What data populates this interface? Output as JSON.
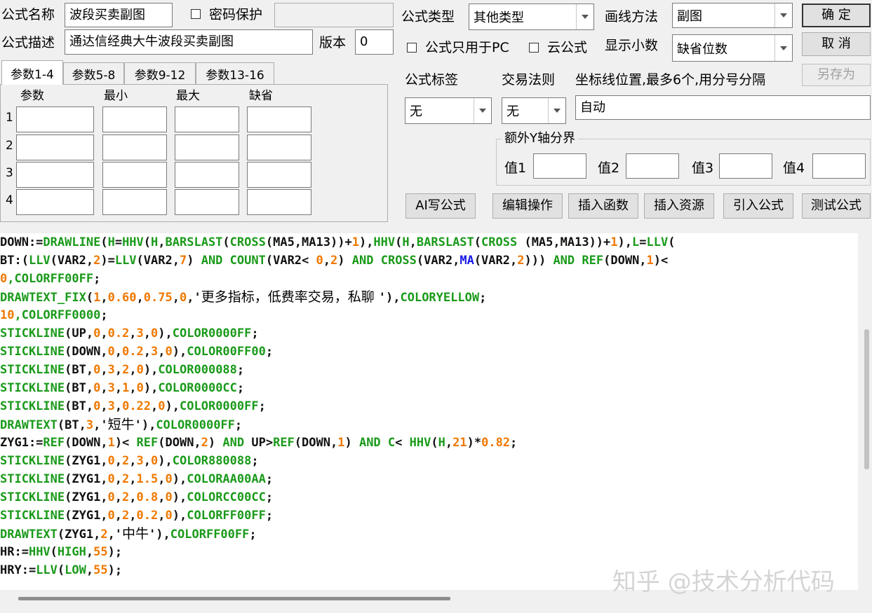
{
  "header": {
    "formula_name_label": "公式名称",
    "formula_name_value": "波段买卖副图",
    "password_label": "密码保护",
    "formula_desc_label": "公式描述",
    "formula_desc_value": "通达信经典大牛波段买卖副图",
    "version_label": "版本",
    "version_value": "0",
    "formula_type_label": "公式类型",
    "formula_type_value": "其他类型",
    "draw_method_label": "画线方法",
    "draw_method_value": "副图",
    "pc_only_label": "公式只用于PC",
    "cloud_label": "云公式",
    "decimals_label": "显示小数",
    "decimals_value": "缺省位数",
    "ok_button": "确  定",
    "cancel_button": "取  消",
    "save_as_button": "另存为",
    "tag_label": "公式标签",
    "tag_value": "无",
    "rule_label": "交易法则",
    "rule_value": "无",
    "axis_label": "坐标线位置,最多6个,用分号分隔",
    "axis_value": "自动",
    "extra_y_label": "额外Y轴分界",
    "extra_y_fields": [
      "值1",
      "值2",
      "值3",
      "值4"
    ]
  },
  "params": {
    "tabs": [
      "参数1-4",
      "参数5-8",
      "参数9-12",
      "参数13-16"
    ],
    "columns": [
      "参数",
      "最小",
      "最大",
      "缺省"
    ],
    "rows": [
      "1",
      "2",
      "3",
      "4"
    ]
  },
  "toolbar": {
    "ai_button": "AI写公式",
    "edit_button": "编辑操作",
    "insert_func_button": "插入函数",
    "insert_res_button": "插入资源",
    "import_button": "引入公式",
    "test_button": "测试公式"
  },
  "code_lines": [
    [
      [
        "pl",
        "DOWN:="
      ],
      [
        "kw",
        "DRAWLINE"
      ],
      [
        "pl",
        "("
      ],
      [
        "kw",
        "H"
      ],
      [
        "pl",
        "="
      ],
      [
        "kw",
        "HHV"
      ],
      [
        "pl",
        "("
      ],
      [
        "kw",
        "H"
      ],
      [
        "pl",
        ","
      ],
      [
        "kw",
        "BARSLAST"
      ],
      [
        "pl",
        "("
      ],
      [
        "kw",
        "CROSS"
      ],
      [
        "pl",
        "(MA5,MA13))+"
      ],
      [
        "num",
        "1"
      ],
      [
        "pl",
        "),"
      ],
      [
        "kw",
        "HHV"
      ],
      [
        "pl",
        "("
      ],
      [
        "kw",
        "H"
      ],
      [
        "pl",
        ","
      ],
      [
        "kw",
        "BARSLAST"
      ],
      [
        "pl",
        "("
      ],
      [
        "kw",
        "CROSS"
      ],
      [
        "pl",
        " (MA5,MA13))+"
      ],
      [
        "num",
        "1"
      ],
      [
        "pl",
        "),"
      ],
      [
        "kw",
        "L"
      ],
      [
        "pl",
        "="
      ],
      [
        "kw",
        "LLV"
      ],
      [
        "pl",
        "("
      ]
    ],
    [
      [
        "pl",
        "BT:("
      ],
      [
        "kw",
        "LLV"
      ],
      [
        "pl",
        "(VAR2,"
      ],
      [
        "num",
        "2"
      ],
      [
        "pl",
        ")="
      ],
      [
        "kw",
        "LLV"
      ],
      [
        "pl",
        "(VAR2,"
      ],
      [
        "num",
        "7"
      ],
      [
        "pl",
        ") "
      ],
      [
        "kw",
        "AND"
      ],
      [
        "pl",
        " "
      ],
      [
        "kw",
        "COUNT"
      ],
      [
        "pl",
        "(VAR2< "
      ],
      [
        "num",
        "0"
      ],
      [
        "pl",
        ","
      ],
      [
        "num",
        "2"
      ],
      [
        "pl",
        ") "
      ],
      [
        "kw",
        "AND"
      ],
      [
        "pl",
        " "
      ],
      [
        "kw",
        "CROSS"
      ],
      [
        "pl",
        "(VAR2,"
      ],
      [
        "bl",
        "MA"
      ],
      [
        "pl",
        "(VAR2,"
      ],
      [
        "num",
        "2"
      ],
      [
        "pl",
        "))) "
      ],
      [
        "kw",
        "AND"
      ],
      [
        "pl",
        " "
      ],
      [
        "kw",
        "REF"
      ],
      [
        "pl",
        "(DOWN,"
      ],
      [
        "num",
        "1"
      ],
      [
        "pl",
        ")<"
      ]
    ],
    [
      [
        "num",
        "0"
      ],
      [
        "kw",
        ",COLORFF00FF"
      ],
      [
        "pl",
        ";"
      ]
    ],
    [
      [
        "kw",
        "DRAWTEXT_FIX"
      ],
      [
        "pl",
        "("
      ],
      [
        "num",
        "1"
      ],
      [
        "pl",
        ","
      ],
      [
        "num",
        "0.60"
      ],
      [
        "pl",
        ","
      ],
      [
        "num",
        "0.75"
      ],
      [
        "pl",
        ","
      ],
      [
        "num",
        "0"
      ],
      [
        "pl",
        ",'"
      ],
      [
        "str",
        "更多指标，低费率交易，私聊 "
      ],
      [
        "pl",
        "'),"
      ],
      [
        "kw",
        "COLORYELLOW"
      ],
      [
        "pl",
        ";"
      ]
    ],
    [
      [
        "num",
        "10"
      ],
      [
        "kw",
        ",COLORFF0000"
      ],
      [
        "pl",
        ";"
      ]
    ],
    [
      [
        "kw",
        "STICKLINE"
      ],
      [
        "pl",
        "(UP,"
      ],
      [
        "num",
        "0"
      ],
      [
        "pl",
        ","
      ],
      [
        "num",
        "0.2"
      ],
      [
        "pl",
        ","
      ],
      [
        "num",
        "3"
      ],
      [
        "pl",
        ","
      ],
      [
        "num",
        "0"
      ],
      [
        "pl",
        "),"
      ],
      [
        "kw",
        "COLOR0000FF"
      ],
      [
        "pl",
        ";"
      ]
    ],
    [
      [
        "kw",
        "STICKLINE"
      ],
      [
        "pl",
        "(DOWN,"
      ],
      [
        "num",
        "0"
      ],
      [
        "pl",
        ","
      ],
      [
        "num",
        "0.2"
      ],
      [
        "pl",
        ","
      ],
      [
        "num",
        "3"
      ],
      [
        "pl",
        ","
      ],
      [
        "num",
        "0"
      ],
      [
        "pl",
        "),"
      ],
      [
        "kw",
        "COLOR00FF00"
      ],
      [
        "pl",
        ";"
      ]
    ],
    [
      [
        "kw",
        "STICKLINE"
      ],
      [
        "pl",
        "(BT,"
      ],
      [
        "num",
        "0"
      ],
      [
        "pl",
        ","
      ],
      [
        "num",
        "3"
      ],
      [
        "pl",
        ","
      ],
      [
        "num",
        "2"
      ],
      [
        "pl",
        ","
      ],
      [
        "num",
        "0"
      ],
      [
        "pl",
        "),"
      ],
      [
        "kw",
        "COLOR000088"
      ],
      [
        "pl",
        ";"
      ]
    ],
    [
      [
        "kw",
        "STICKLINE"
      ],
      [
        "pl",
        "(BT,"
      ],
      [
        "num",
        "0"
      ],
      [
        "pl",
        ","
      ],
      [
        "num",
        "3"
      ],
      [
        "pl",
        ","
      ],
      [
        "num",
        "1"
      ],
      [
        "pl",
        ","
      ],
      [
        "num",
        "0"
      ],
      [
        "pl",
        "),"
      ],
      [
        "kw",
        "COLOR0000CC"
      ],
      [
        "pl",
        ";"
      ]
    ],
    [
      [
        "kw",
        "STICKLINE"
      ],
      [
        "pl",
        "(BT,"
      ],
      [
        "num",
        "0"
      ],
      [
        "pl",
        ","
      ],
      [
        "num",
        "3"
      ],
      [
        "pl",
        ","
      ],
      [
        "num",
        "0.22"
      ],
      [
        "pl",
        ","
      ],
      [
        "num",
        "0"
      ],
      [
        "pl",
        "),"
      ],
      [
        "kw",
        "COLOR0000FF"
      ],
      [
        "pl",
        ";"
      ]
    ],
    [
      [
        "kw",
        "DRAWTEXT"
      ],
      [
        "pl",
        "(BT,"
      ],
      [
        "num",
        "3"
      ],
      [
        "pl",
        ",'"
      ],
      [
        "str",
        "短牛"
      ],
      [
        "pl",
        "'),"
      ],
      [
        "kw",
        "COLOR0000FF"
      ],
      [
        "pl",
        ";"
      ]
    ],
    [
      [
        "pl",
        "ZYG1:="
      ],
      [
        "kw",
        "REF"
      ],
      [
        "pl",
        "(DOWN,"
      ],
      [
        "num",
        "1"
      ],
      [
        "pl",
        ")< "
      ],
      [
        "kw",
        "REF"
      ],
      [
        "pl",
        "(DOWN,"
      ],
      [
        "num",
        "2"
      ],
      [
        "pl",
        ") "
      ],
      [
        "kw",
        "AND"
      ],
      [
        "pl",
        " UP>"
      ],
      [
        "kw",
        "REF"
      ],
      [
        "pl",
        "(DOWN,"
      ],
      [
        "num",
        "1"
      ],
      [
        "pl",
        ") "
      ],
      [
        "kw",
        "AND"
      ],
      [
        "pl",
        " "
      ],
      [
        "kw",
        "C"
      ],
      [
        "pl",
        "< "
      ],
      [
        "kw",
        "HHV"
      ],
      [
        "pl",
        "("
      ],
      [
        "kw",
        "H"
      ],
      [
        "pl",
        ","
      ],
      [
        "num",
        "21"
      ],
      [
        "pl",
        ")*"
      ],
      [
        "num",
        "0.82"
      ],
      [
        "pl",
        ";"
      ]
    ],
    [
      [
        "kw",
        "STICKLINE"
      ],
      [
        "pl",
        "(ZYG1,"
      ],
      [
        "num",
        "0"
      ],
      [
        "pl",
        ","
      ],
      [
        "num",
        "2"
      ],
      [
        "pl",
        ","
      ],
      [
        "num",
        "3"
      ],
      [
        "pl",
        ","
      ],
      [
        "num",
        "0"
      ],
      [
        "pl",
        "),"
      ],
      [
        "kw",
        "COLOR880088"
      ],
      [
        "pl",
        ";"
      ]
    ],
    [
      [
        "kw",
        "STICKLINE"
      ],
      [
        "pl",
        "(ZYG1,"
      ],
      [
        "num",
        "0"
      ],
      [
        "pl",
        ","
      ],
      [
        "num",
        "2"
      ],
      [
        "pl",
        ","
      ],
      [
        "num",
        "1.5"
      ],
      [
        "pl",
        ","
      ],
      [
        "num",
        "0"
      ],
      [
        "pl",
        "),"
      ],
      [
        "kw",
        "COLORAA00AA"
      ],
      [
        "pl",
        ";"
      ]
    ],
    [
      [
        "kw",
        "STICKLINE"
      ],
      [
        "pl",
        "(ZYG1,"
      ],
      [
        "num",
        "0"
      ],
      [
        "pl",
        ","
      ],
      [
        "num",
        "2"
      ],
      [
        "pl",
        ","
      ],
      [
        "num",
        "0.8"
      ],
      [
        "pl",
        ","
      ],
      [
        "num",
        "0"
      ],
      [
        "pl",
        "),"
      ],
      [
        "kw",
        "COLORCC00CC"
      ],
      [
        "pl",
        ";"
      ]
    ],
    [
      [
        "kw",
        "STICKLINE"
      ],
      [
        "pl",
        "(ZYG1,"
      ],
      [
        "num",
        "0"
      ],
      [
        "pl",
        ","
      ],
      [
        "num",
        "2"
      ],
      [
        "pl",
        ","
      ],
      [
        "num",
        "0.2"
      ],
      [
        "pl",
        ","
      ],
      [
        "num",
        "0"
      ],
      [
        "pl",
        "),"
      ],
      [
        "kw",
        "COLORFF00FF"
      ],
      [
        "pl",
        ";"
      ]
    ],
    [
      [
        "kw",
        "DRAWTEXT"
      ],
      [
        "pl",
        "(ZYG1,"
      ],
      [
        "num",
        "2"
      ],
      [
        "pl",
        ",'"
      ],
      [
        "str",
        "中牛"
      ],
      [
        "pl",
        "'),"
      ],
      [
        "kw",
        "COLORFF00FF"
      ],
      [
        "pl",
        ";"
      ]
    ],
    [
      [
        "pl",
        "HR:="
      ],
      [
        "kw",
        "HHV"
      ],
      [
        "pl",
        "("
      ],
      [
        "kw",
        "HIGH"
      ],
      [
        "pl",
        ","
      ],
      [
        "num",
        "55"
      ],
      [
        "pl",
        ");"
      ]
    ],
    [
      [
        "pl",
        "HRY:="
      ],
      [
        "kw",
        "LLV"
      ],
      [
        "pl",
        "("
      ],
      [
        "kw",
        "LOW"
      ],
      [
        "pl",
        ","
      ],
      [
        "num",
        "55"
      ],
      [
        "pl",
        ");"
      ]
    ]
  ],
  "watermark": "知乎 @技术分析代码",
  "colors": {
    "keyword": "#1a9a1a",
    "number": "#f07800",
    "plain": "#111111",
    "builtin": "#1818e8"
  }
}
